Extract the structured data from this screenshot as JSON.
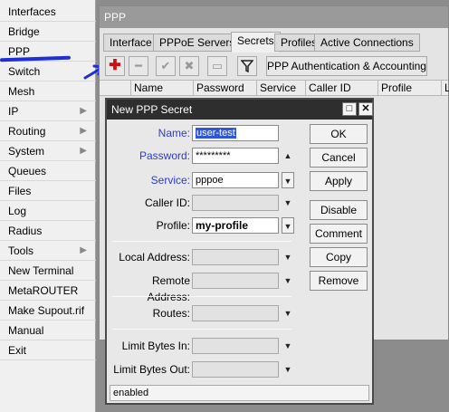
{
  "menu": {
    "items": [
      {
        "label": "Interfaces",
        "submenu": false
      },
      {
        "label": "Bridge",
        "submenu": false
      },
      {
        "label": "PPP",
        "submenu": false
      },
      {
        "label": "Switch",
        "submenu": false
      },
      {
        "label": "Mesh",
        "submenu": false
      },
      {
        "label": "IP",
        "submenu": true
      },
      {
        "label": "Routing",
        "submenu": true
      },
      {
        "label": "System",
        "submenu": true
      },
      {
        "label": "Queues",
        "submenu": false
      },
      {
        "label": "Files",
        "submenu": false
      },
      {
        "label": "Log",
        "submenu": false
      },
      {
        "label": "Radius",
        "submenu": false
      },
      {
        "label": "Tools",
        "submenu": true
      },
      {
        "label": "New Terminal",
        "submenu": false
      },
      {
        "label": "MetaROUTER",
        "submenu": false
      },
      {
        "label": "Make Supout.rif",
        "submenu": false
      },
      {
        "label": "Manual",
        "submenu": false
      },
      {
        "label": "Exit",
        "submenu": false
      }
    ],
    "submenu_glyph": "▶"
  },
  "ppp_window": {
    "title": "PPP",
    "tabs": [
      "Interface",
      "PPPoE Servers",
      "Secrets",
      "Profiles",
      "Active Connections"
    ],
    "active_tab": "Secrets",
    "toolbar": {
      "icons": [
        "add-icon",
        "remove-icon",
        "enable-icon",
        "disable-icon",
        "comment-icon",
        "filter-icon"
      ],
      "auth_button": "PPP Authentication & Accounting"
    },
    "columns": [
      "",
      "Name",
      "Password",
      "Service",
      "Caller ID",
      "Profile",
      "L"
    ]
  },
  "dialog": {
    "title": "New PPP Secret",
    "controls": {
      "restore": "□",
      "close": "✕"
    },
    "fields": {
      "name": {
        "label": "Name:",
        "value": "user-test"
      },
      "password": {
        "label": "Password:",
        "value": "*********"
      },
      "service": {
        "label": "Service:",
        "value": "pppoe"
      },
      "caller_id": {
        "label": "Caller ID:",
        "value": ""
      },
      "profile": {
        "label": "Profile:",
        "value": "my-profile"
      },
      "local_address": {
        "label": "Local Address:",
        "value": ""
      },
      "remote_address": {
        "label": "Remote Address:",
        "value": ""
      },
      "routes": {
        "label": "Routes:",
        "value": ""
      },
      "limit_bytes_in": {
        "label": "Limit Bytes In:",
        "value": ""
      },
      "limit_bytes_out": {
        "label": "Limit Bytes Out:",
        "value": ""
      }
    },
    "buttons": [
      "OK",
      "Cancel",
      "Apply",
      "Disable",
      "Comment",
      "Copy",
      "Remove"
    ],
    "status": "enabled"
  },
  "glyphs": {
    "up": "▲",
    "down": "▼",
    "dropdown": "▼"
  },
  "colors": {
    "accent_blue": "#2a3bd0",
    "annotation_blue": "#1d2fd6",
    "add_red": "#d01010",
    "selection": "#2d56d8"
  }
}
